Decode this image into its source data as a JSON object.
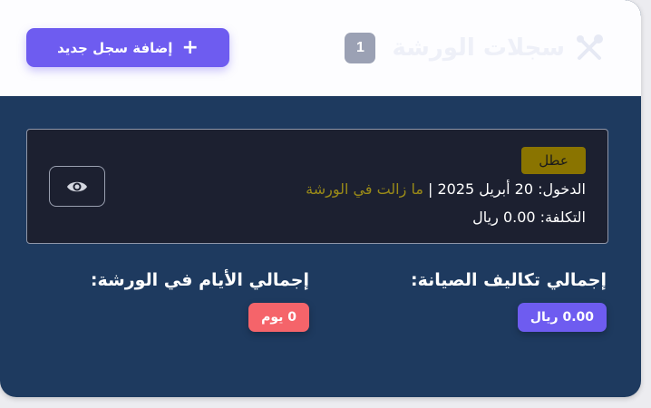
{
  "header": {
    "title": "سجلات الورشة",
    "icon": "tools-icon",
    "count": "1",
    "add_button": {
      "label": "إضافة سجل جديد",
      "icon": "plus-icon"
    }
  },
  "record": {
    "status": "عطل",
    "entry_label": "الدخول:",
    "entry_date": "20 أبريل 2025",
    "separator": "|",
    "entry_status": "ما زالت في الورشة",
    "cost_label": "التكلفة:",
    "cost_value": "0.00 ريال",
    "view_icon": "eye-icon"
  },
  "summary": {
    "total_costs_label": "إجمالي تكاليف الصيانة:",
    "total_costs_value": "0.00 ريال",
    "total_days_label": "إجمالي الأيام في الورشة:",
    "total_days_value": "0 يوم"
  },
  "colors": {
    "accent": "#6e5cf0",
    "panel": "#1e3a5f",
    "record_bg": "#1c2030",
    "status_badge": "#8a7400",
    "status_text": "#9a8a18",
    "days_pill": "#f5646a"
  }
}
